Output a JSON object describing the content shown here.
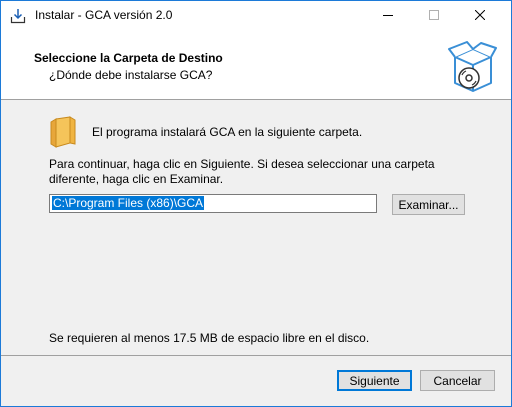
{
  "window": {
    "title": "Instalar - GCA versión 2.0",
    "controls": [
      "minimize",
      "maximize",
      "close"
    ]
  },
  "header": {
    "title": "Seleccione la Carpeta de Destino",
    "subtitle": "¿Dónde debe instalarse GCA?",
    "graphic_icon": "setup-box-disc-icon"
  },
  "body": {
    "folder_icon": "folder-icon",
    "intro": "El programa instalará GCA en la siguiente carpeta.",
    "instructions": "Para continuar, haga clic en Siguiente. Si desea seleccionar una carpeta diferente, haga clic en Examinar.",
    "path_value": "C:\\Program Files (x86)\\GCA",
    "browse_label": "Examinar...",
    "space_required": "Se requieren al menos 17.5 MB de espacio libre en el disco."
  },
  "footer": {
    "next_label": "Siguiente",
    "cancel_label": "Cancelar"
  },
  "colors": {
    "accent": "#0078d7",
    "window_border": "#1c7ad8",
    "dialog_background": "#f0f0f0",
    "folder": "#f0b441"
  }
}
